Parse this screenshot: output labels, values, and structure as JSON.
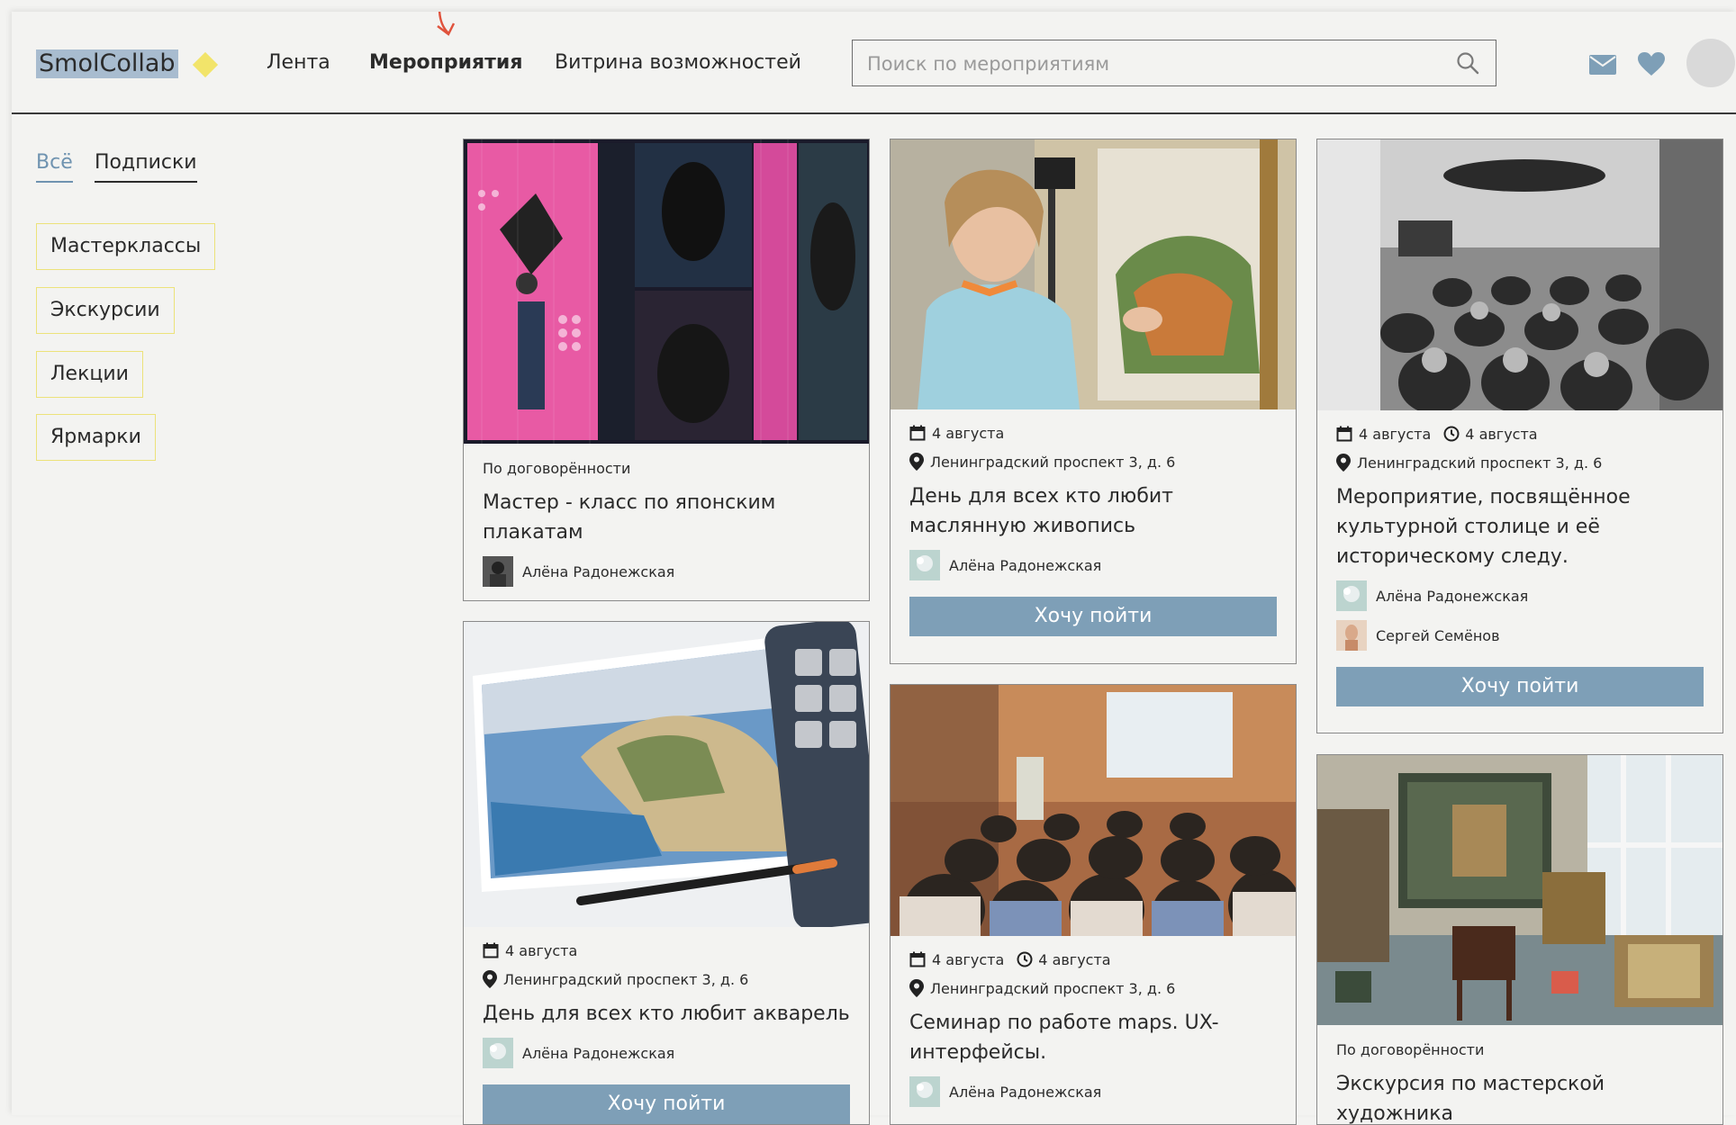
{
  "header": {
    "logo": "SmolCollab",
    "nav": [
      "Лента",
      "Мероприятия",
      "Витрина возможностей"
    ],
    "search_placeholder": "Поиск по мероприятиям"
  },
  "tabs": [
    "Всё",
    "Подписки"
  ],
  "categories": [
    "Мастерклассы",
    "Экскурсии",
    "Лекции",
    "Ярмарки"
  ],
  "cards": [
    {
      "price": "По договорённости",
      "title_l1": "Мастер - класс по японским",
      "title_l2": "плакатам",
      "author": "Алёна Радонежская"
    },
    {
      "date": "4 августа",
      "address": "Ленинградский проспект 3, д. 6",
      "title_l1": "День для всех кто любит",
      "title_l2": "маслянную живопись",
      "author": "Алёна Радонежская",
      "button": "Хочу пойти"
    },
    {
      "date": "4 августа",
      "time": "4 августа",
      "address": "Ленинградский проспект 3, д. 6",
      "title_l1": "Мероприятие, посвящённое",
      "title_l2": "культурной столице и её",
      "title_l3": "историческому следу.",
      "author": "Алёна Радонежская",
      "author2": "Сергей Семёнов",
      "button": "Хочу пойти"
    },
    {
      "date": "4 августа",
      "address": "Ленинградский проспект 3, д. 6",
      "title_l1": "День для всех кто любит акварель",
      "author": "Алёна Радонежская",
      "button": "Хочу пойти"
    },
    {
      "date": "4 августа",
      "time": "4 августа",
      "address": "Ленинградский проспект 3, д. 6",
      "title_l1": "Семинар по работе maps. UX-",
      "title_l2": "интерфейсы.",
      "author": "Алёна Радонежская"
    },
    {
      "price": "По договорённости",
      "title_l1": "Экскурсия по мастерской",
      "title_l2": "художника"
    }
  ],
  "colors": {
    "accent_blue": "#7e9fb7",
    "chip_border": "#ece27a",
    "logo_diamond": "#f2e46a",
    "logo_highlight": "#a8bccf"
  }
}
